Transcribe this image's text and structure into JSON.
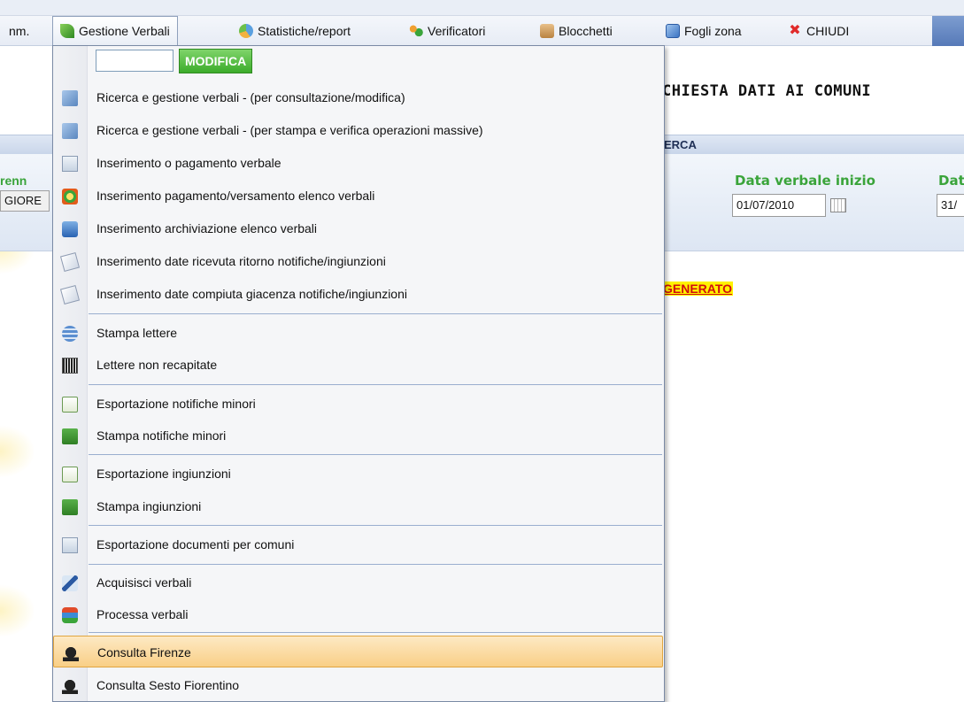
{
  "menubar": {
    "truncated_item": "nm.",
    "items": [
      {
        "label": "Gestione Verbali",
        "icon": "leaf-icon"
      },
      {
        "label": "Statistiche/report",
        "icon": "pie-chart-icon"
      },
      {
        "label": "Verificatori",
        "icon": "people-icon"
      },
      {
        "label": "Blocchetti",
        "icon": "box-icon"
      },
      {
        "label": "Fogli zona",
        "icon": "map-icon"
      },
      {
        "label": "CHIUDI",
        "icon": "close-icon"
      }
    ]
  },
  "page": {
    "heading": "CHIESTA DATI AI COMUNI",
    "search_panel_label": "ERCA",
    "left_label": "renn",
    "left_value": "GIORE",
    "date_start_label": "Data verbale inizio",
    "date_start_value": "01/07/2010",
    "date_end_label": "Dat",
    "date_end_value": "31/",
    "generated_link": "GENERATO"
  },
  "dropdown": {
    "code_input_value": "",
    "modifica_label": "MODIFICA",
    "items": [
      {
        "label": "Ricerca e gestione verbali - (per consultazione/modifica)",
        "icon": "search-doc-icon"
      },
      {
        "label": "Ricerca e gestione verbali - (per stampa e verifica operazioni massive)",
        "icon": "search-doc-icon"
      },
      {
        "label": "Inserimento o pagamento verbale",
        "icon": "insert-doc-icon"
      },
      {
        "label": "Inserimento pagamento/versamento elenco verbali",
        "icon": "payment-icon"
      },
      {
        "label": "Inserimento archiviazione elenco verbali",
        "icon": "archive-icon"
      },
      {
        "label": "Inserimento date ricevuta ritorno notifiche/ingiunzioni",
        "icon": "mail-icon"
      },
      {
        "label": "Inserimento date compiuta giacenza notifiche/ingiunzioni",
        "icon": "mail-icon"
      },
      {
        "label": "Stampa lettere",
        "icon": "layers-icon"
      },
      {
        "label": "Lettere non recapitate",
        "icon": "barcode-icon"
      },
      {
        "label": "Esportazione notifiche minori",
        "icon": "page-icon"
      },
      {
        "label": "Stampa notifiche minori",
        "icon": "green-doc-icon"
      },
      {
        "label": "Esportazione ingiunzioni",
        "icon": "page-icon"
      },
      {
        "label": "Stampa ingiunzioni",
        "icon": "green-doc-icon"
      },
      {
        "label": "Esportazione documenti per comuni",
        "icon": "add-doc-icon"
      },
      {
        "label": "Acquisisci verbali",
        "icon": "pen-icon"
      },
      {
        "label": "Processa verbali",
        "icon": "books-icon"
      },
      {
        "label": "Consulta Firenze",
        "icon": "bell-icon",
        "highlighted": true
      },
      {
        "label": "Consulta Sesto Fiorentino",
        "icon": "bell-icon"
      }
    ]
  }
}
